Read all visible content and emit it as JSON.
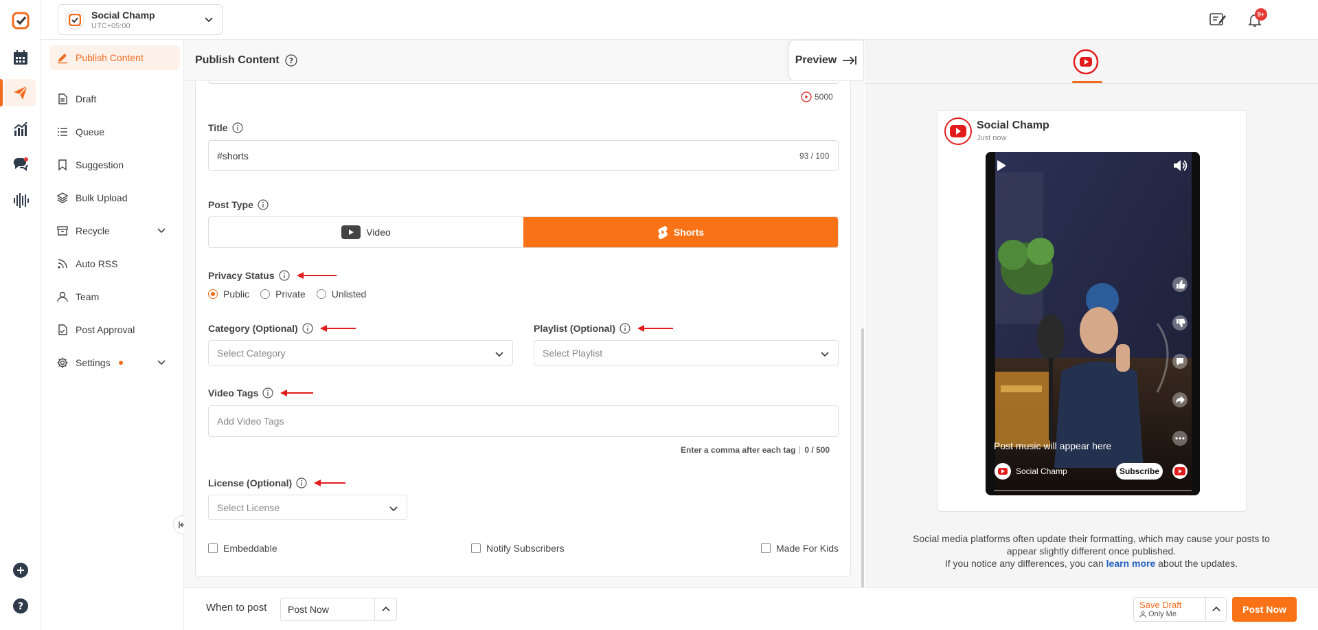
{
  "workspace": {
    "name": "Social Champ",
    "timezone": "UTC+05:00"
  },
  "sidebar": {
    "items": [
      {
        "label": "Publish Content",
        "icon": "pen-icon"
      },
      {
        "label": "Draft",
        "icon": "document-icon"
      },
      {
        "label": "Queue",
        "icon": "list-icon"
      },
      {
        "label": "Suggestion",
        "icon": "bookmark-icon"
      },
      {
        "label": "Bulk Upload",
        "icon": "layers-icon"
      },
      {
        "label": "Recycle",
        "icon": "archive-icon"
      },
      {
        "label": "Auto RSS",
        "icon": "rss-icon"
      },
      {
        "label": "Team",
        "icon": "user-icon"
      },
      {
        "label": "Post Approval",
        "icon": "file-check-icon"
      },
      {
        "label": "Settings",
        "icon": "gear-icon"
      }
    ]
  },
  "header": {
    "title": "Publish Content",
    "preview_label": "Preview",
    "notification_badge": "9+"
  },
  "form": {
    "char_count": "5000",
    "title_label": "Title",
    "title_value": "#shorts",
    "title_counter": "93 / 100",
    "post_type_label": "Post Type",
    "post_type_options": [
      "Video",
      "Shorts"
    ],
    "post_type_selected": "Shorts",
    "privacy_label": "Privacy Status",
    "privacy_options": [
      "Public",
      "Private",
      "Unlisted"
    ],
    "privacy_selected": "Public",
    "category_label": "Category (Optional)",
    "category_placeholder": "Select Category",
    "playlist_label": "Playlist (Optional)",
    "playlist_placeholder": "Select Playlist",
    "tags_label": "Video Tags",
    "tags_placeholder": "Add Video Tags",
    "tags_hint": "Enter a comma after each tag",
    "tags_counter": "0 / 500",
    "license_label": "License (Optional)",
    "license_placeholder": "Select License",
    "checkboxes": [
      "Embeddable",
      "Notify Subscribers",
      "Made For Kids"
    ]
  },
  "bottom": {
    "when_label": "When to post",
    "when_value": "Post Now",
    "save_draft": "Save Draft",
    "save_draft_scope": "Only Me",
    "post_button": "Post Now"
  },
  "preview": {
    "account_name": "Social Champ",
    "time": "Just now",
    "music_text": "Post music will appear here",
    "channel_name": "Social Champ",
    "subscribe_label": "Subscribe",
    "disclaimer_1": "Social media platforms often update their formatting, which may cause your posts to appear slightly different once published.",
    "disclaimer_2_pre": "If you notice any differences, you can",
    "disclaimer_link": "learn more",
    "disclaimer_2_post": "about the updates."
  },
  "colors": {
    "accent": "#f97316",
    "youtube": "#e21b1b",
    "link": "#1f5fbf"
  }
}
